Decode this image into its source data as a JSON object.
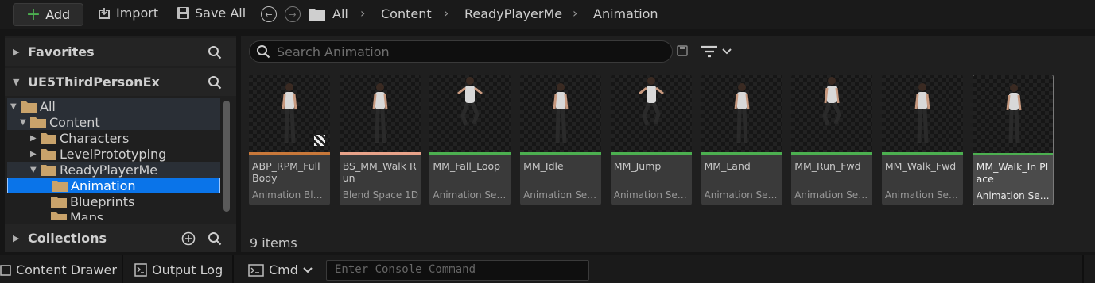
{
  "toolbar": {
    "add_label": "Add",
    "import_label": "Import",
    "save_all_label": "Save All",
    "breadcrumbs": [
      "All",
      "Content",
      "ReadyPlayerMe",
      "Animation"
    ]
  },
  "left_panel": {
    "favorites_label": "Favorites",
    "project_label": "UE5ThirdPersonEx",
    "collections_label": "Collections",
    "tree": [
      {
        "label": "All"
      },
      {
        "label": "Content"
      },
      {
        "label": "Characters"
      },
      {
        "label": "LevelPrototyping"
      },
      {
        "label": "ReadyPlayerMe"
      },
      {
        "label": "Animation"
      },
      {
        "label": "Blueprints"
      },
      {
        "label": "Maps"
      }
    ]
  },
  "content": {
    "search_placeholder": "Search Animation",
    "items_count": "9 items",
    "assets": [
      {
        "name": "ABP_RPM_Full Body",
        "type": "Animation Blue...",
        "color": "#c8783a"
      },
      {
        "name": "BS_MM_Walk Run",
        "type": "Blend Space 1D",
        "color": "#e8a38a"
      },
      {
        "name": "MM_Fall_Loop",
        "type": "Animation Sequ...",
        "color": "#4caf50"
      },
      {
        "name": "MM_Idle",
        "type": "Animation Sequ...",
        "color": "#4caf50"
      },
      {
        "name": "MM_Jump",
        "type": "Animation Sequ...",
        "color": "#4caf50"
      },
      {
        "name": "MM_Land",
        "type": "Animation Sequ...",
        "color": "#4caf50"
      },
      {
        "name": "MM_Run_Fwd",
        "type": "Animation Sequ...",
        "color": "#4caf50"
      },
      {
        "name": "MM_Walk_Fwd",
        "type": "Animation Sequ...",
        "color": "#4caf50"
      },
      {
        "name": "MM_Walk_In Place",
        "type": "Animation Sequ...",
        "color": "#4caf50"
      }
    ]
  },
  "statusbar": {
    "content_drawer_label": "Content Drawer",
    "output_log_label": "Output Log",
    "cmd_label": "Cmd",
    "console_placeholder": "Enter Console Command"
  },
  "colors": {
    "selection": "#0a74e9",
    "add_icon": "#4caf50",
    "folder": "#c9a36b"
  }
}
